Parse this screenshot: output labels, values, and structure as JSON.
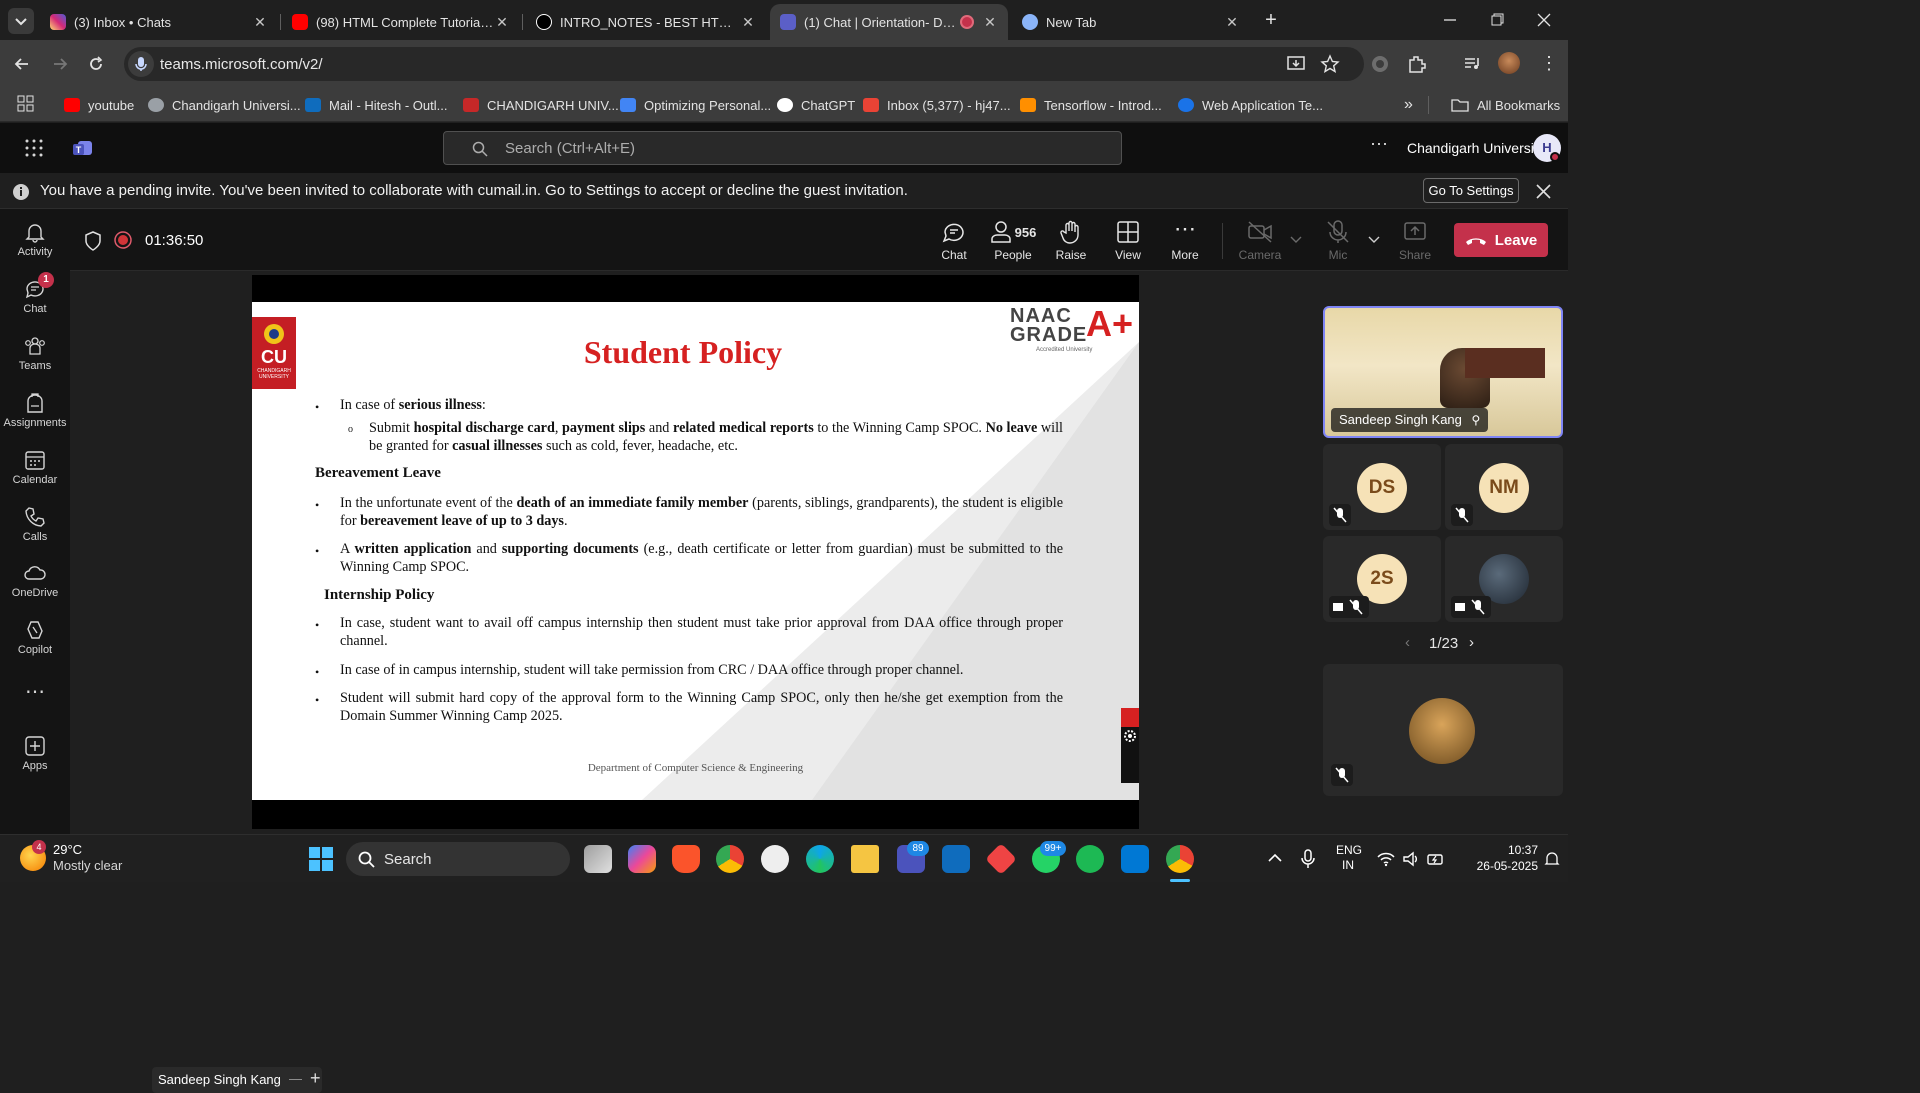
{
  "browser": {
    "tabs": [
      {
        "title": "(3) Inbox • Chats",
        "icon": "instagram-icon",
        "color": "#d6249f"
      },
      {
        "title": "(98) HTML Complete Tutorial fo",
        "icon": "youtube-icon",
        "color": "#ff0000"
      },
      {
        "title": "INTRO_NOTES - BEST HTML CO",
        "icon": "notion-icon",
        "color": "#ffffff"
      },
      {
        "title": "(1) Chat | Orientation- Dom",
        "icon": "teams-icon",
        "color": "#5b5fc7"
      },
      {
        "title": "New Tab",
        "icon": "chrome-icon",
        "color": "#8ab4f8"
      }
    ],
    "url": "teams.microsoft.com/v2/",
    "bookmarks": [
      {
        "label": "youtube",
        "icon": "youtube-icon",
        "color": "#ff0000"
      },
      {
        "label": "Chandigarh Universi...",
        "icon": "globe-icon",
        "color": "#9aa0a6"
      },
      {
        "label": "Mail - Hitesh - Outl...",
        "icon": "outlook-icon",
        "color": "#0f6cbd"
      },
      {
        "label": "CHANDIGARH UNIV...",
        "icon": "cu-icon",
        "color": "#c62828"
      },
      {
        "label": "Optimizing Personal...",
        "icon": "docs-icon",
        "color": "#4285f4"
      },
      {
        "label": "ChatGPT",
        "icon": "chatgpt-icon",
        "color": "#ffffff"
      },
      {
        "label": "Inbox (5,377) - hj47...",
        "icon": "gmail-icon",
        "color": "#ea4335"
      },
      {
        "label": "Tensorflow - Introd...",
        "icon": "tensorflow-icon",
        "color": "#ff8f00"
      },
      {
        "label": "Web Application Te...",
        "icon": "c-icon",
        "color": "#1a73e8"
      }
    ],
    "all_bookmarks": "All Bookmarks"
  },
  "teams": {
    "search_placeholder": "Search (Ctrl+Alt+E)",
    "org": "Chandigarh University",
    "avatar_initial": "H",
    "banner": "You have a pending invite. You've been invited to collaborate with cumail.in. Go to Settings to accept or decline the guest invitation.",
    "banner_button": "Go To Settings",
    "rail": [
      {
        "label": "Activity",
        "icon": "bell-icon"
      },
      {
        "label": "Chat",
        "icon": "chat-icon",
        "badge": "1"
      },
      {
        "label": "Teams",
        "icon": "teams-people-icon"
      },
      {
        "label": "Assignments",
        "icon": "backpack-icon"
      },
      {
        "label": "Calendar",
        "icon": "calendar-icon"
      },
      {
        "label": "Calls",
        "icon": "phone-icon"
      },
      {
        "label": "OneDrive",
        "icon": "cloud-icon"
      },
      {
        "label": "Copilot",
        "icon": "copilot-icon"
      },
      {
        "label": "Apps",
        "icon": "apps-add-icon"
      }
    ]
  },
  "meeting": {
    "timer": "01:36:50",
    "controls": {
      "chat": "Chat",
      "people": "People",
      "people_count": "956",
      "raise": "Raise",
      "view": "View",
      "more": "More",
      "camera": "Camera",
      "mic": "Mic",
      "share": "Share",
      "leave": "Leave"
    },
    "presenter_name": "Sandeep Singh Kang",
    "participants": [
      {
        "name": "Sandeep Singh Kang",
        "type": "video"
      },
      {
        "initials": "DS"
      },
      {
        "initials": "NM"
      },
      {
        "initials": "2S"
      },
      {
        "type": "photo"
      }
    ],
    "pagination": "1/23"
  },
  "slide": {
    "title": "Student Policy",
    "logo_text": "CU",
    "logo_sub": "CHANDIGARH UNIVERSITY",
    "naac_line1": "NAAC",
    "naac_line2": "GRADE",
    "naac_grade": "A+",
    "naac_sub": "Accredited University",
    "illness_lead": "In case of ",
    "illness_bold": "serious illness",
    "illness_end": ":",
    "sub1_a": "Submit ",
    "sub1_b": "hospital discharge card",
    "sub1_c": ", ",
    "sub1_d": "payment slips",
    "sub1_e": " and ",
    "sub1_f": "related medical reports",
    "sub1_g": " to the Winning Camp SPOC. ",
    "sub1_h": "No leave",
    "sub1_i": " will be granted for ",
    "sub1_j": "casual illnesses",
    "sub1_k": " such as cold, fever, headache, etc.",
    "h_bereavement": "Bereavement Leave",
    "b1_a": "In the unfortunate event of the ",
    "b1_b": "death of an immediate family member",
    "b1_c": " (parents, siblings, grandparents), the student is eligible for ",
    "b1_d": "bereavement leave of up to 3 days",
    "b1_e": ".",
    "b2_a": "A ",
    "b2_b": "written application",
    "b2_c": " and ",
    "b2_d": "supporting documents",
    "b2_e": " (e.g., death certificate or letter from guardian) must be submitted to the Winning Camp SPOC.",
    "h_internship": "Internship Policy",
    "i1": "In case, student want to avail off campus internship then student must take prior approval from DAA office through proper channel.",
    "i2": "In case of in campus internship, student will take permission from CRC / DAA office through proper channel.",
    "i3": "Student will submit hard copy of the approval form to the Winning Camp SPOC, only then he/she get exemption from the Domain Summer Winning Camp 2025.",
    "footer": "Department of Computer Science & Engineering"
  },
  "taskbar": {
    "weather_temp": "29°C",
    "weather_desc": "Mostly clear",
    "weather_badge": "4",
    "search": "Search",
    "teams_badge": "89",
    "whatsapp_badge": "99+",
    "lang1": "ENG",
    "lang2": "IN",
    "time": "10:37",
    "date": "26-05-2025"
  }
}
